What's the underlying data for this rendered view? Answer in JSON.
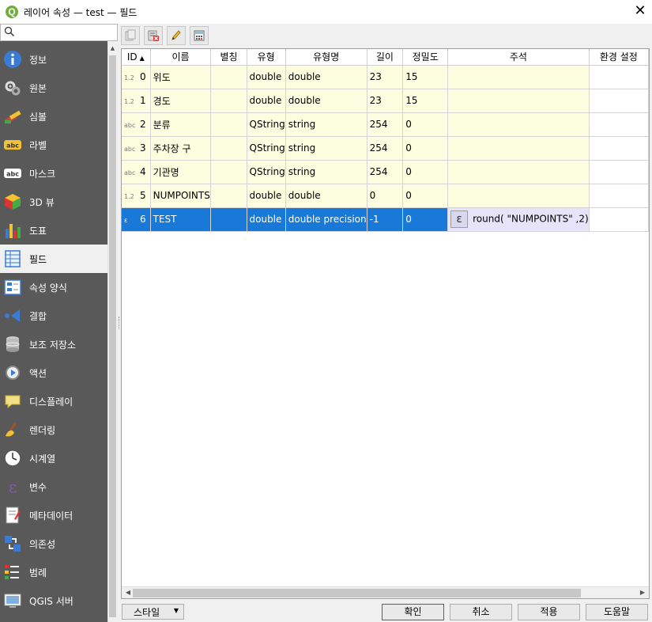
{
  "window": {
    "title": "레이어 속성 — test — 필드",
    "app_icon": "Q",
    "close_glyph": "✕"
  },
  "sidebar": {
    "search_placeholder": "",
    "items": [
      {
        "label": "정보",
        "icon": "info-icon"
      },
      {
        "label": "원본",
        "icon": "source-icon"
      },
      {
        "label": "심볼",
        "icon": "symbology-icon"
      },
      {
        "label": "라벨",
        "icon": "labels-icon"
      },
      {
        "label": "마스크",
        "icon": "mask-icon"
      },
      {
        "label": "3D 뷰",
        "icon": "3d-view-icon"
      },
      {
        "label": "도표",
        "icon": "diagrams-icon"
      },
      {
        "label": "필드",
        "icon": "fields-icon",
        "active": true
      },
      {
        "label": "속성 양식",
        "icon": "attributes-form-icon"
      },
      {
        "label": "결합",
        "icon": "joins-icon"
      },
      {
        "label": "보조 저장소",
        "icon": "auxiliary-storage-icon"
      },
      {
        "label": "액션",
        "icon": "actions-icon"
      },
      {
        "label": "디스플레이",
        "icon": "display-icon"
      },
      {
        "label": "렌더링",
        "icon": "rendering-icon"
      },
      {
        "label": "시계열",
        "icon": "temporal-icon"
      },
      {
        "label": "변수",
        "icon": "variables-icon"
      },
      {
        "label": "메타데이터",
        "icon": "metadata-icon"
      },
      {
        "label": "의존성",
        "icon": "dependencies-icon"
      },
      {
        "label": "범례",
        "icon": "legend-icon"
      },
      {
        "label": "QGIS 서버",
        "icon": "qgis-server-icon"
      }
    ]
  },
  "toolbar": {
    "buttons": [
      "new-field-icon",
      "delete-field-icon",
      "edit-mode-icon",
      "field-calculator-icon"
    ]
  },
  "table": {
    "headers": [
      "ID",
      "이름",
      "별칭",
      "유형",
      "유형명",
      "길이",
      "정밀도",
      "주석",
      "환경 설정"
    ],
    "sort_glyph": "▲",
    "rows": [
      {
        "tag": "1.2",
        "id": "0",
        "name": "위도",
        "alias": "",
        "type": "double",
        "typename": "double",
        "length": "23",
        "precision": "15",
        "comment": ""
      },
      {
        "tag": "1.2",
        "id": "1",
        "name": "경도",
        "alias": "",
        "type": "double",
        "typename": "double",
        "length": "23",
        "precision": "15",
        "comment": ""
      },
      {
        "tag": "abc",
        "id": "2",
        "name": "분류",
        "alias": "",
        "type": "QString",
        "typename": "string",
        "length": "254",
        "precision": "0",
        "comment": ""
      },
      {
        "tag": "abc",
        "id": "3",
        "name": "주차장 구",
        "alias": "",
        "type": "QString",
        "typename": "string",
        "length": "254",
        "precision": "0",
        "comment": ""
      },
      {
        "tag": "abc",
        "id": "4",
        "name": "기관명",
        "alias": "",
        "type": "QString",
        "typename": "string",
        "length": "254",
        "precision": "0",
        "comment": ""
      },
      {
        "tag": "1.2",
        "id": "5",
        "name": "NUMPOINTS",
        "alias": "",
        "type": "double",
        "typename": "double",
        "length": "0",
        "precision": "0",
        "comment": ""
      },
      {
        "tag": "ε",
        "id": "6",
        "name": "TEST",
        "alias": "",
        "type": "double",
        "typename": "double precision",
        "length": "-1",
        "precision": "0",
        "comment": "round( \"NUMPOINTS\" ,2)",
        "expression_glyph": "ε",
        "selected": true
      }
    ]
  },
  "buttons": {
    "style": "스타일",
    "ok": "확인",
    "cancel": "취소",
    "apply": "적용",
    "help": "도움말"
  }
}
